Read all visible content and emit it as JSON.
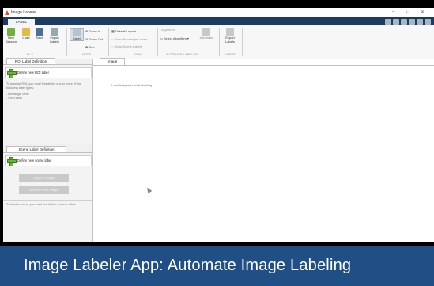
{
  "app": {
    "title": "Image Labeler"
  },
  "ribbon": {
    "tab": "LABEL",
    "buttons": {
      "new_session": "New Session",
      "load": "Load",
      "save": "Save",
      "import_labels": "Import Labels",
      "label": "Label",
      "zoom_in": "Zoom In",
      "zoom_out": "Zoom Out",
      "pan": "Pan",
      "default_layout": "Default Layout",
      "show_rect": "Show Rectangle Labels",
      "show_scene": "Show Scene Labels",
      "algorithm_header": "Algorithm",
      "select_algorithm": "Select Algorithm",
      "automate": "Automate",
      "export_labels": "Export Labels"
    },
    "groups": {
      "file": "FILE",
      "mode": "MODE",
      "view": "VIEW",
      "automate": "AUTOMATE LABELING",
      "export": "EXPORT"
    }
  },
  "left": {
    "roi_tab": "ROI Label Definition",
    "roi_define": "Define new ROI label",
    "roi_help": "To label an ROI, you must first define one or more of the following label types:",
    "roi_types": "- Rectangle label\n- Pixel label",
    "scene_tab": "Scene Label Definition",
    "scene_define": "Define new scene label",
    "apply": "Apply to Image",
    "remove": "Remove from Image",
    "scene_help": "To label a scene, you must first define a scene label."
  },
  "main": {
    "tab": "Image",
    "placeholder": "Load images to start labeling."
  },
  "banner": {
    "text": "Image Labeler App: Automate Image Labeling"
  },
  "colors": {
    "accent": "#1f4f85",
    "tabbar": "#1e3b62",
    "plus": "#6cb33e"
  }
}
